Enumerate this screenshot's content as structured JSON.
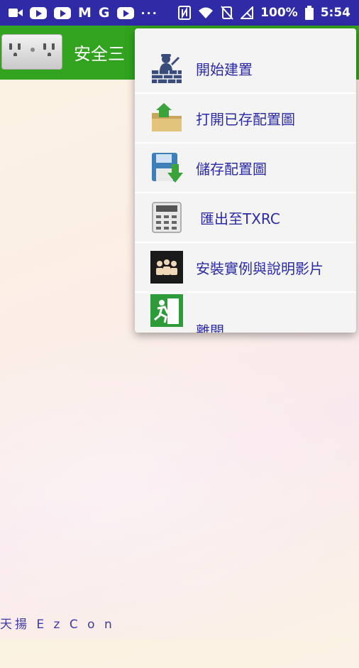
{
  "status_bar": {
    "left_icons": [
      "video-camera-icon",
      "youtube-icon",
      "youtube-icon",
      "gmail-icon",
      "google-icon",
      "youtube-icon",
      "more-dots-icon"
    ],
    "letter_m": "M",
    "letter_g": "G",
    "dots": "···",
    "right_icons": [
      "nfc-icon",
      "wifi-icon",
      "mute-icon",
      "no-signal-icon",
      "battery-icon"
    ],
    "battery": "100%",
    "time": "5:54"
  },
  "app_bar": {
    "title": "安全三",
    "icon": "outlet-icon"
  },
  "menu": {
    "items": [
      {
        "label": "開始建置",
        "icon": "builder-icon"
      },
      {
        "label": "打開已存配置圖",
        "icon": "open-folder-icon"
      },
      {
        "label": "儲存配置圖",
        "icon": "save-icon"
      },
      {
        "label": "匯出至TXRC",
        "icon": "remote-control-icon"
      },
      {
        "label": "安裝實例與說明影片",
        "icon": "video-audience-icon"
      },
      {
        "label": "離開",
        "icon": "exit-icon"
      }
    ]
  },
  "footer": {
    "text": "天揚 E z C o n"
  },
  "colors": {
    "status_bar": "#2f2aa5",
    "app_bar": "#31a31e",
    "menu_text": "#2b2aa8"
  }
}
